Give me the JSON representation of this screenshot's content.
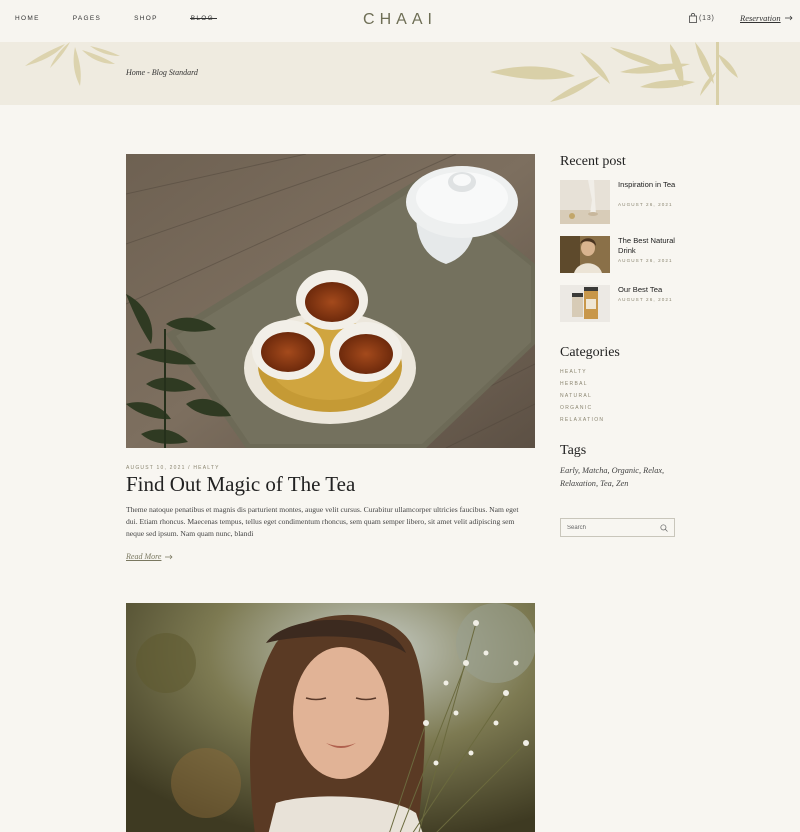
{
  "header": {
    "nav": [
      "HOME",
      "PAGES",
      "SHOP",
      "BLOG"
    ],
    "logo": "CHAAI",
    "cart_count": "(13)",
    "reservation": "Reservation"
  },
  "banner": {
    "breadcrumb": "Home - Blog Standard"
  },
  "post": {
    "meta": "AUGUST 10, 2021 / HEALTY",
    "title": "Find Out Magic of The Tea",
    "excerpt": "Theme natoque penatibus et magnis dis parturient montes, augue velit cursus. Curabitur ullamcorper ultricies faucibus. Nam eget dui. Etiam rhoncus. Maecenas tempus, tellus eget condimentum rhoncus, sem quam semper libero, sit amet velit adipiscing sem neque sed ipsum. Nam quam nunc, blandi",
    "read_more": "Read More"
  },
  "sidebar": {
    "recent_heading": "Recent post",
    "recent": [
      {
        "title": "Inspiration in Tea",
        "date": "AUGUST 26, 2021"
      },
      {
        "title": "The Best Natural Drink",
        "date": "AUGUST 26, 2021"
      },
      {
        "title": "Our Best Tea",
        "date": "AUGUST 26, 2021"
      }
    ],
    "categories_heading": "Categories",
    "categories": [
      "HEALTY",
      "HERBAL",
      "NATURAL",
      "ORGANIC",
      "RELAXATION"
    ],
    "tags_heading": "Tags",
    "tags": [
      "Early,",
      "Matcha,",
      "Organic,",
      "Relax,",
      "Relaxation,",
      "Tea,",
      "Zen"
    ],
    "search_placeholder": "Search"
  },
  "colors": {
    "background": "#f8f6f1",
    "banner": "#efebe0",
    "accent": "#8a8570",
    "leaf": "#d9d0a8"
  }
}
